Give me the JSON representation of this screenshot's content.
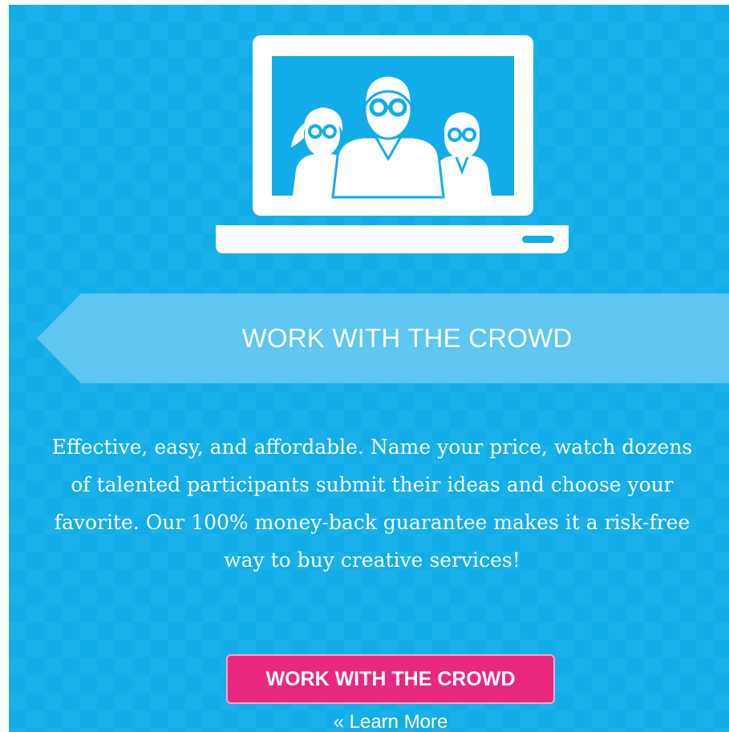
{
  "section": {
    "background_color": "#12ade8",
    "icon": "laptop-crowd-icon"
  },
  "ribbon": {
    "title": "WORK WITH THE CROWD",
    "color": "#5ec6f0"
  },
  "description": "Effective, easy, and affordable. Name your price, watch dozens of talented participants submit their ideas and choose your favorite. Our 100% money-back guarantee makes it a risk-free way to buy creative services!",
  "cta": {
    "label": "WORK WITH THE CROWD",
    "color": "#e9277f"
  },
  "learn_more": {
    "label": "« Learn More"
  }
}
